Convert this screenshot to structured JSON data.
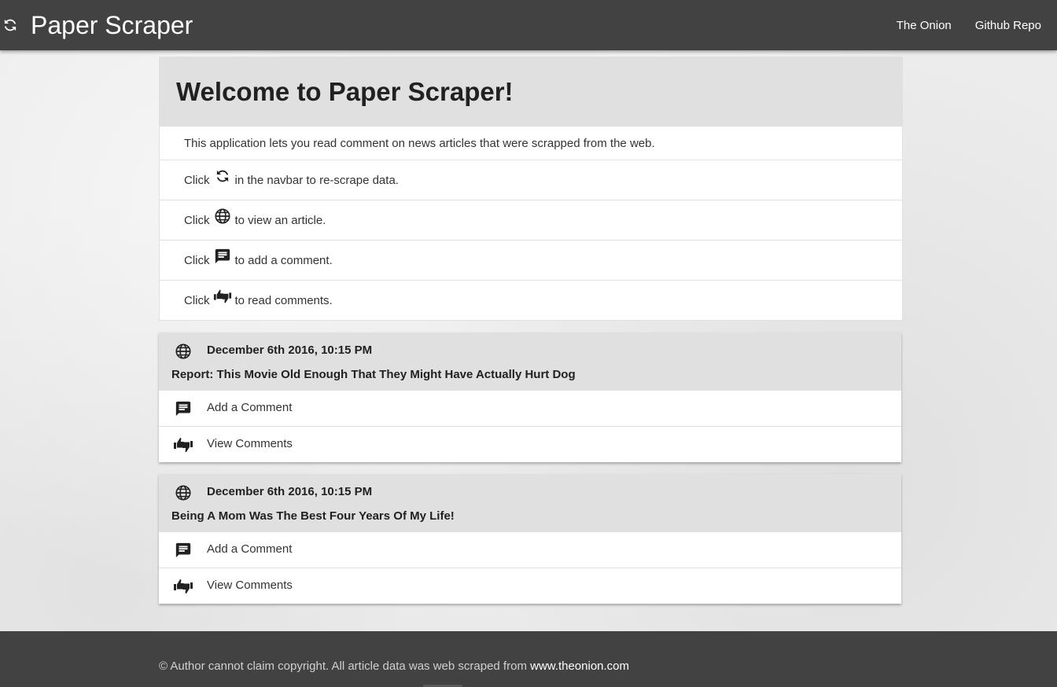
{
  "navbar": {
    "brand": "Paper Scraper",
    "refresh_icon": "refresh-icon",
    "links": [
      "The Onion",
      "Github Repo"
    ]
  },
  "welcome": {
    "title": "Welcome to Paper Scraper!",
    "intro": "This application lets you read comment on news articles that were scrapped from the web.",
    "items": [
      {
        "prefix": "Click",
        "icon": "refresh-icon",
        "suffix": "in the navbar to re-scrape data."
      },
      {
        "prefix": "Click",
        "icon": "globe-icon",
        "suffix": "to view an article."
      },
      {
        "prefix": "Click",
        "icon": "comment-icon",
        "suffix": "to add a comment."
      },
      {
        "prefix": "Click",
        "icon": "thumbs-icon",
        "suffix": "to read comments."
      }
    ]
  },
  "articles": [
    {
      "date": "December 6th 2016, 10:15 PM",
      "title": "Report: This Movie Old Enough That They Might Have Actually Hurt Dog",
      "add_label": "Add a Comment",
      "view_label": "View Comments"
    },
    {
      "date": "December 6th 2016, 10:15 PM",
      "title": "Being A Mom Was The Best Four Years Of My Life!",
      "add_label": "Add a Comment",
      "view_label": "View Comments"
    }
  ],
  "footer": {
    "text": "© Author cannot claim copyright. All article data was web scraped from",
    "link": "www.theonion.com"
  },
  "colors": {
    "navbar_bg": "#424242",
    "card_header_bg": "#e0e0e0",
    "text": "#212121"
  }
}
